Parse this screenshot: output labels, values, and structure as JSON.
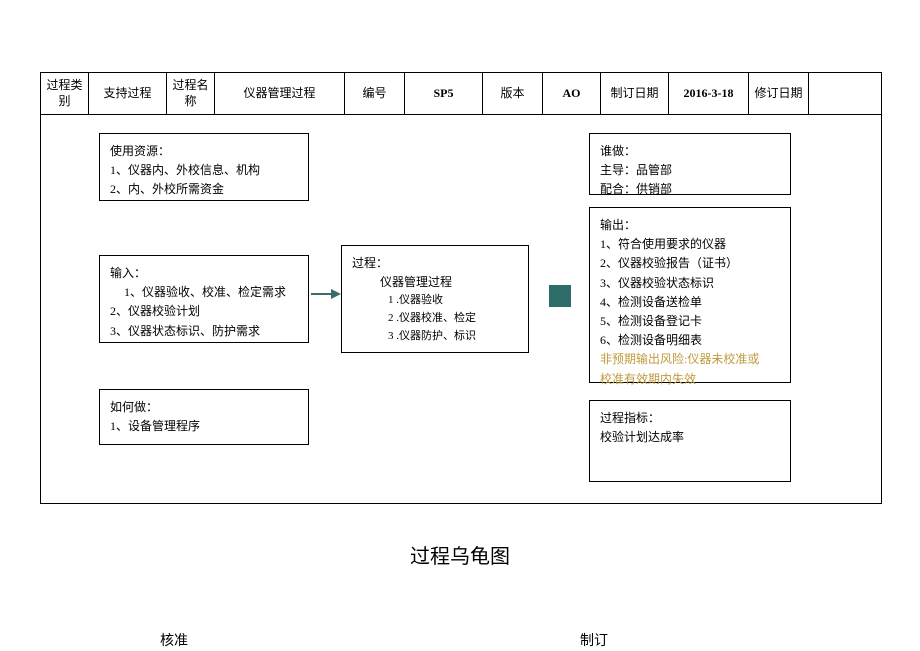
{
  "header": {
    "cat_label": "过程类别",
    "cat_value": "支持过程",
    "name_label": "过程名称",
    "name_value": "仪器管理过程",
    "code_label": "编号",
    "code_value": "SP5",
    "ver_label": "版本",
    "ver_value": "AO",
    "date_label": "制订日期",
    "date_value": "2016-3-18",
    "rev_label": "修订日期",
    "rev_value": ""
  },
  "resources": {
    "title": "使用资源：",
    "l1": "1、仪器内、外校信息、机构",
    "l2": "2、内、外校所需资金"
  },
  "who": {
    "title": "谁做：",
    "l1": "主导：品管部",
    "l2": "配合：供销部"
  },
  "input": {
    "title": "输入：",
    "l1": "1、仪器验收、校准、检定需求",
    "l2": "2、仪器校验计划",
    "l3": "3、仪器状态标识、防护需求"
  },
  "proc": {
    "title": "过程：",
    "subtitle": "仪器管理过程",
    "l1": "1 .仪器验收",
    "l2": "2 .仪器校准、检定",
    "l3": "3 .仪器防护、标识"
  },
  "output": {
    "title": "输出：",
    "l1": "1、符合使用要求的仪器",
    "l2": "2、仪器校验报告（证书）",
    "l3": "3、仪器校验状态标识",
    "l4": "4、检测设备送检单",
    "l5": "5、检测设备登记卡",
    "l6": "6、检测设备明细表",
    "risk1": "非预期输出风险:仪器未校准或",
    "risk2": "校准有效期内失效"
  },
  "how": {
    "title": "如何做：",
    "l1": "1、设备管理程序"
  },
  "kpi": {
    "title": "过程指标：",
    "l1": "校验计划达成率"
  },
  "page_title": "过程乌龟图",
  "footer": {
    "approve": "核准",
    "draft": "制订"
  }
}
